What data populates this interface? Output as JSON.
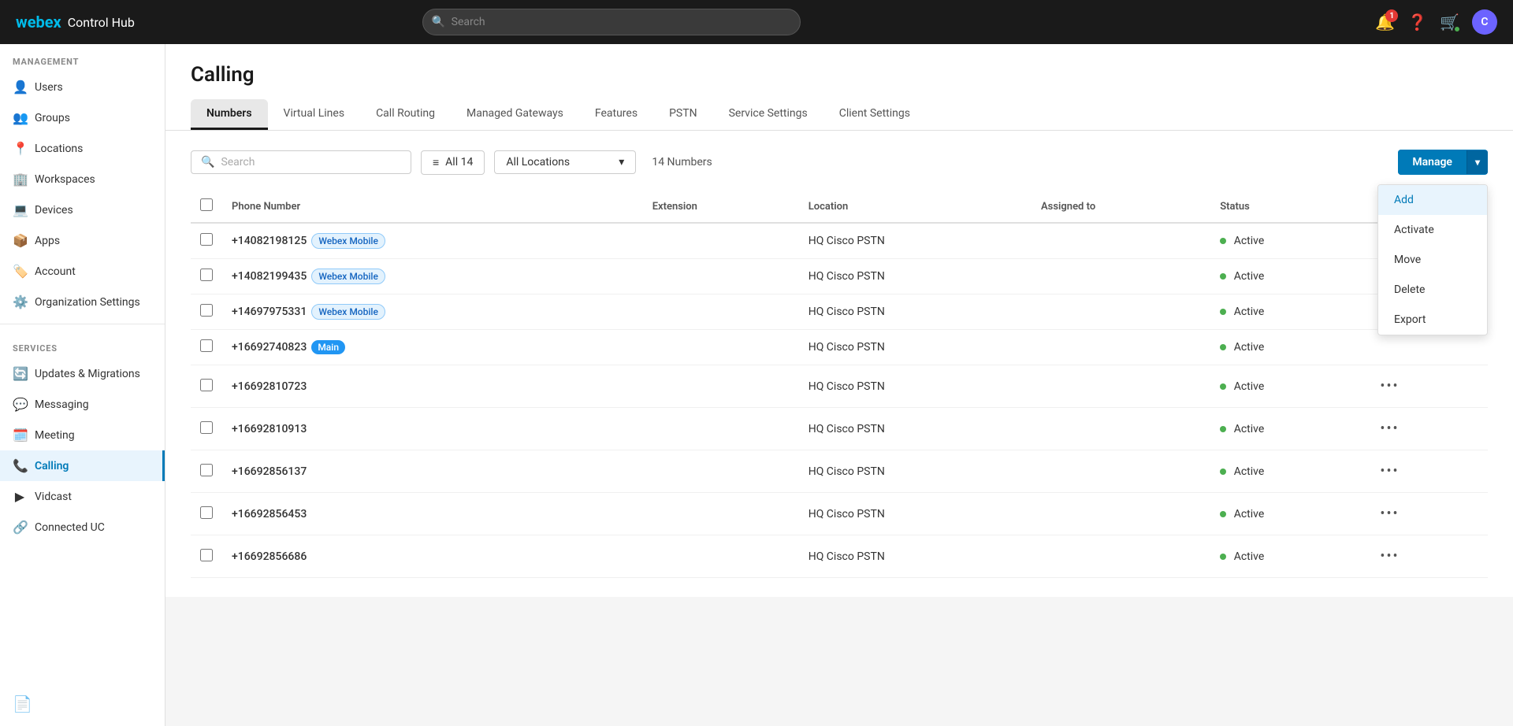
{
  "app": {
    "logo_webex": "webex",
    "logo_hub": "Control Hub",
    "search_placeholder": "Search",
    "notification_badge": "1",
    "avatar_initial": "C"
  },
  "sidebar": {
    "management_label": "MANAGEMENT",
    "services_label": "SERVICES",
    "items_management": [
      {
        "id": "users",
        "label": "Users",
        "icon": "👤"
      },
      {
        "id": "groups",
        "label": "Groups",
        "icon": "👥"
      },
      {
        "id": "locations",
        "label": "Locations",
        "icon": "📍"
      },
      {
        "id": "workspaces",
        "label": "Workspaces",
        "icon": "🏢"
      },
      {
        "id": "devices",
        "label": "Devices",
        "icon": "💻"
      },
      {
        "id": "apps",
        "label": "Apps",
        "icon": "📦"
      },
      {
        "id": "account",
        "label": "Account",
        "icon": "🏷️"
      },
      {
        "id": "org-settings",
        "label": "Organization Settings",
        "icon": "⚙️"
      }
    ],
    "items_services": [
      {
        "id": "updates",
        "label": "Updates & Migrations",
        "icon": "🔄"
      },
      {
        "id": "messaging",
        "label": "Messaging",
        "icon": "💬"
      },
      {
        "id": "meeting",
        "label": "Meeting",
        "icon": "🗓️"
      },
      {
        "id": "calling",
        "label": "Calling",
        "icon": "📞",
        "active": true
      },
      {
        "id": "vidcast",
        "label": "Vidcast",
        "icon": "▶"
      },
      {
        "id": "connected-uc",
        "label": "Connected UC",
        "icon": "🔗"
      }
    ],
    "footer_icon": "📄"
  },
  "page": {
    "title": "Calling",
    "tabs": [
      {
        "id": "numbers",
        "label": "Numbers",
        "active": true
      },
      {
        "id": "virtual-lines",
        "label": "Virtual Lines",
        "active": false
      },
      {
        "id": "call-routing",
        "label": "Call Routing",
        "active": false
      },
      {
        "id": "managed-gateways",
        "label": "Managed Gateways",
        "active": false
      },
      {
        "id": "features",
        "label": "Features",
        "active": false
      },
      {
        "id": "pstn",
        "label": "PSTN",
        "active": false
      },
      {
        "id": "service-settings",
        "label": "Service Settings",
        "active": false
      },
      {
        "id": "client-settings",
        "label": "Client Settings",
        "active": false
      }
    ]
  },
  "table": {
    "filter_all_label": "All 14",
    "filter_icon": "≡",
    "search_placeholder": "Search",
    "location_placeholder": "All Locations",
    "numbers_count": "14 Numbers",
    "manage_label": "Manage",
    "manage_dropdown_icon": "▾",
    "columns": [
      {
        "id": "phone",
        "label": "Phone Number"
      },
      {
        "id": "extension",
        "label": "Extension"
      },
      {
        "id": "location",
        "label": "Location"
      },
      {
        "id": "assigned",
        "label": "Assigned to"
      },
      {
        "id": "status",
        "label": "Status"
      }
    ],
    "dropdown_items": [
      {
        "id": "add",
        "label": "Add",
        "highlighted": true
      },
      {
        "id": "activate",
        "label": "Activate"
      },
      {
        "id": "move",
        "label": "Move"
      },
      {
        "id": "delete",
        "label": "Delete"
      },
      {
        "id": "export",
        "label": "Export"
      }
    ],
    "rows": [
      {
        "phone": "+14082198125",
        "tag": "Webex Mobile",
        "tag_type": "blue",
        "extension": "",
        "location": "HQ Cisco PSTN",
        "assigned": "",
        "status": "Active"
      },
      {
        "phone": "+14082199435",
        "tag": "Webex Mobile",
        "tag_type": "blue",
        "extension": "",
        "location": "HQ Cisco PSTN",
        "assigned": "",
        "status": "Active"
      },
      {
        "phone": "+14697975331",
        "tag": "Webex Mobile",
        "tag_type": "blue",
        "extension": "",
        "location": "HQ Cisco PSTN",
        "assigned": "",
        "status": "Active"
      },
      {
        "phone": "+16692740823",
        "tag": "Main",
        "tag_type": "main",
        "extension": "",
        "location": "HQ Cisco PSTN",
        "assigned": "",
        "status": "Active"
      },
      {
        "phone": "+16692810723",
        "tag": "",
        "tag_type": "",
        "extension": "",
        "location": "HQ Cisco PSTN",
        "assigned": "",
        "status": "Active"
      },
      {
        "phone": "+16692810913",
        "tag": "",
        "tag_type": "",
        "extension": "",
        "location": "HQ Cisco PSTN",
        "assigned": "",
        "status": "Active"
      },
      {
        "phone": "+16692856137",
        "tag": "",
        "tag_type": "",
        "extension": "",
        "location": "HQ Cisco PSTN",
        "assigned": "",
        "status": "Active"
      },
      {
        "phone": "+16692856453",
        "tag": "",
        "tag_type": "",
        "extension": "",
        "location": "HQ Cisco PSTN",
        "assigned": "",
        "status": "Active"
      },
      {
        "phone": "+16692856686",
        "tag": "",
        "tag_type": "",
        "extension": "",
        "location": "HQ Cisco PSTN",
        "assigned": "",
        "status": "Active"
      }
    ]
  }
}
